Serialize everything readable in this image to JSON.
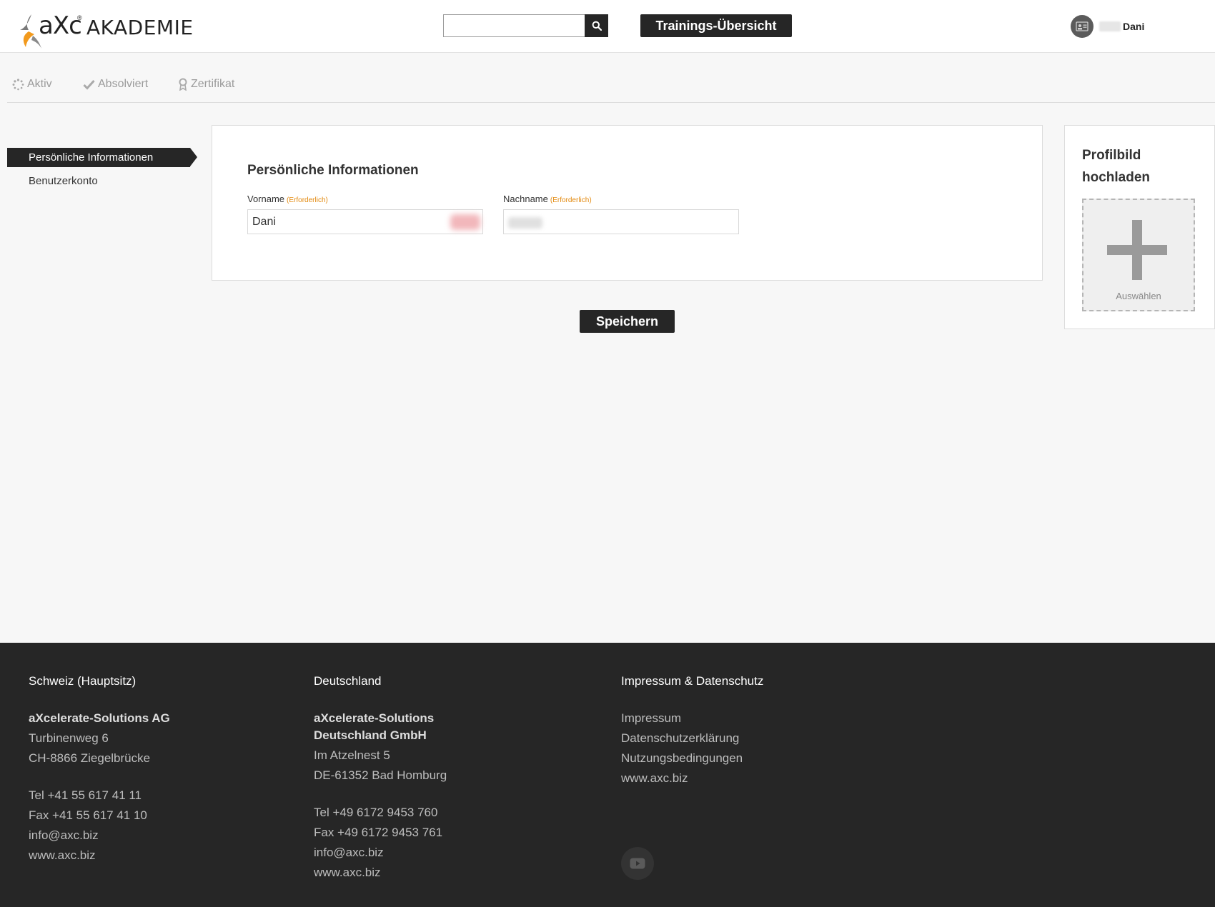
{
  "header": {
    "logo_brand": "aXc",
    "logo_reg": "®",
    "logo_akademie": "AKADEMIE",
    "search_placeholder": "",
    "overview_button": "Trainings-Übersicht",
    "user_name": "Dani"
  },
  "tabs": [
    {
      "label": "Aktiv",
      "icon": "spinner-icon"
    },
    {
      "label": "Absolviert",
      "icon": "check-icon"
    },
    {
      "label": "Zertifikat",
      "icon": "certificate-icon"
    }
  ],
  "sidenav": {
    "active": "Persönliche Informationen",
    "items": [
      "Benutzerkonto"
    ]
  },
  "form": {
    "title": "Persönliche Informationen",
    "first_name_label": "Vorname",
    "last_name_label": "Nachname",
    "required": "(Erforderlich)",
    "first_name_value": "Dani",
    "last_name_value": "",
    "save_button": "Speichern"
  },
  "profile": {
    "title": "Profilbild hochladen",
    "upload_label": "Auswählen"
  },
  "footer": {
    "ch": {
      "heading": "Schweiz (Hauptsitz)",
      "company": "aXcelerate-Solutions AG",
      "street": "Turbinenweg 6",
      "city": "CH-8866 Ziegelbrücke",
      "tel": "Tel +41 55 617 41 11",
      "fax": "Fax +41 55 617 41 10",
      "email": "info@axc.biz",
      "web": "www.axc.biz"
    },
    "de": {
      "heading": "Deutschland",
      "company_line1": "aXcelerate-Solutions",
      "company_line2": "Deutschland GmbH",
      "street": "Im Atzelnest 5",
      "city": "DE-61352 Bad Homburg",
      "tel": "Tel +49 6172 9453 760",
      "fax": "Fax +49 6172 9453 761",
      "email": "info@axc.biz",
      "web": "www.axc.biz"
    },
    "legal": {
      "heading": "Impressum & Datenschutz",
      "links": [
        "Impressum",
        "Datenschutzerklärung",
        "Nutzungsbedingungen",
        "www.axc.biz"
      ]
    }
  },
  "colors": {
    "dark": "#262626",
    "accent_orange": "#e38a10",
    "background": "#f7f7f7"
  }
}
